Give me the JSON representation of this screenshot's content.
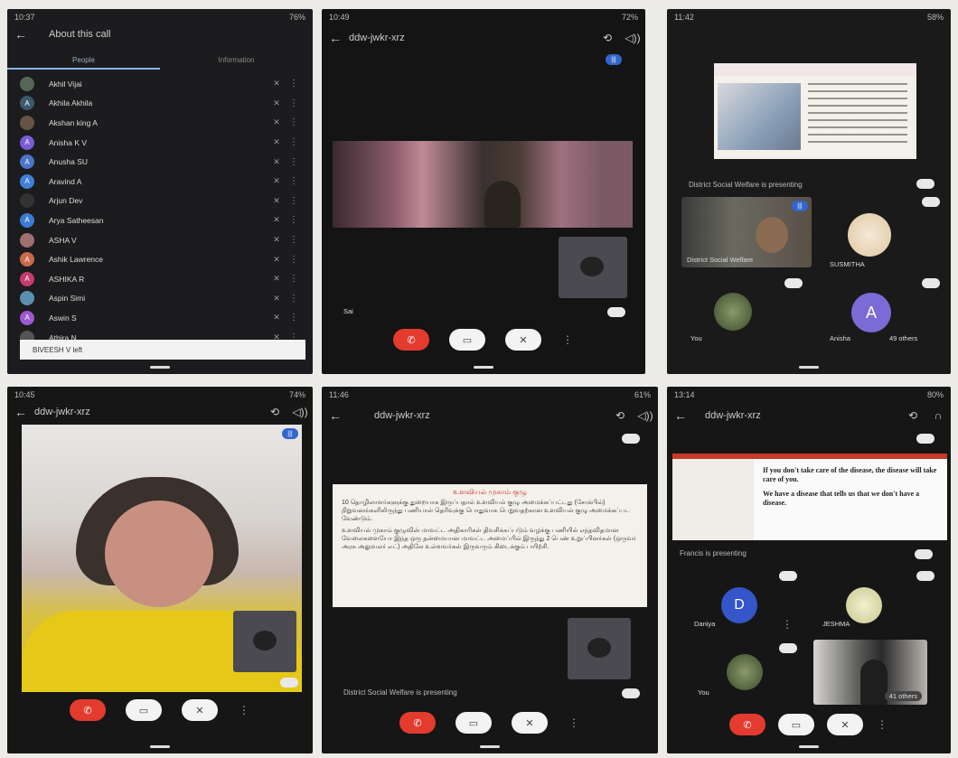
{
  "p1": {
    "status_time": "10:37",
    "status_battery": "76%",
    "title": "About this call",
    "tabs": [
      "People",
      "Information"
    ],
    "participants": [
      {
        "name": "Akhil Vijai",
        "initial": "",
        "color": "#556655"
      },
      {
        "name": "Akhila Akhila",
        "initial": "A",
        "color": "#3c5a6a"
      },
      {
        "name": "Akshan king A",
        "initial": "",
        "color": "#665544"
      },
      {
        "name": "Anisha K V",
        "initial": "A",
        "color": "#7a5bd6"
      },
      {
        "name": "Anusha SU",
        "initial": "A",
        "color": "#4a73c9"
      },
      {
        "name": "Aravind A",
        "initial": "A",
        "color": "#3f7fd9"
      },
      {
        "name": "Arjun Dev",
        "initial": "",
        "color": "#333333"
      },
      {
        "name": "Arya Satheesan",
        "initial": "A",
        "color": "#3a7bd5"
      },
      {
        "name": "ASHA V",
        "initial": "",
        "color": "#a07070"
      },
      {
        "name": "Ashik Lawrence",
        "initial": "A",
        "color": "#c96b4a"
      },
      {
        "name": "ASHIKA R",
        "initial": "A",
        "color": "#c43b6f"
      },
      {
        "name": "Aspin Simi",
        "initial": "",
        "color": "#5b8fb0"
      },
      {
        "name": "Aswin S",
        "initial": "A",
        "color": "#9b59d0"
      },
      {
        "name": "Athira N",
        "initial": "",
        "color": "#555555"
      }
    ],
    "toast": "BIVEESH V left"
  },
  "p2": {
    "status_time": "10:49",
    "status_battery": "72%",
    "meeting_code": "ddw-jwkr-xrz",
    "self_label": "Sai"
  },
  "p3": {
    "status_time": "11:42",
    "status_battery": "58%",
    "presenting": "District Social Welfare is presenting",
    "tiles": {
      "district": "District Social Welfare",
      "sumitha": "SUSMITHA",
      "you": "You",
      "anisha": "Anisha",
      "others": "49 others"
    },
    "anisha_initial": "A"
  },
  "p4": {
    "status_time": "10:45",
    "status_battery": "74%",
    "meeting_code": "ddw-jwkr-xrz"
  },
  "p5": {
    "status_time": "11:46",
    "status_battery": "61%",
    "meeting_code": "ddw-jwkr-xrz",
    "slide_heading": "உளவியல் முகாம் குழு",
    "slide_text_1": "10 தொழிலாளர்களுக்கு துறையாக இருப்பதால் உளவியல் குழு அமைக்கப்பட்டது (சோக்பில்) நிறுவனங்களிலிருந்து பணியாள் தெரிவுக்கு பொதுவாக பெறுவதற்கான உளவியல் குழு அமைக்கப்பட வேண்டும்.",
    "slide_text_2": "உளவியல் முகாம் குழுவின் மாவட்ட அதிகாரிகள் திவசிக்கப்படும் வழக்கு பணியில் எந்தவிதமான வேலைகளையோ இந்த ஒரு தன்மையான மாவட்ட அமைப்பில் இருந்து 2 பெண் உறுப்பினர்கள் (ஒருவர் அரசு அலுவலர் எட்) அதிலே உள்ளவர்கள் இருவரும் கிடைக்கும் பயிற்சி.",
    "presenting": "District Social Welfare is presenting"
  },
  "p6": {
    "status_time": "13:14",
    "status_battery": "80%",
    "meeting_code": "ddw-jwkr-xrz",
    "slide_bullets": [
      "If you don't take care of the disease, the disease will take care of you.",
      "We have a disease that tells us that we don't have a disease."
    ],
    "presenting": "Francis is presenting",
    "tiles": {
      "daniya": "Daniya",
      "jeshma": "JESHMA",
      "you": "You",
      "others": "41 others"
    },
    "daniya_initial": "D"
  },
  "icons": {
    "back": "←",
    "mic_off": "✕",
    "end": "✆",
    "more": "⋮",
    "speaker": "◁))",
    "camera_flip": "⟲"
  },
  "colors": {
    "end_call": "#e33b2e",
    "accent_blue": "#3366cc",
    "anisha_purple": "#7b6bd6",
    "daniya_blue": "#3456c8"
  }
}
